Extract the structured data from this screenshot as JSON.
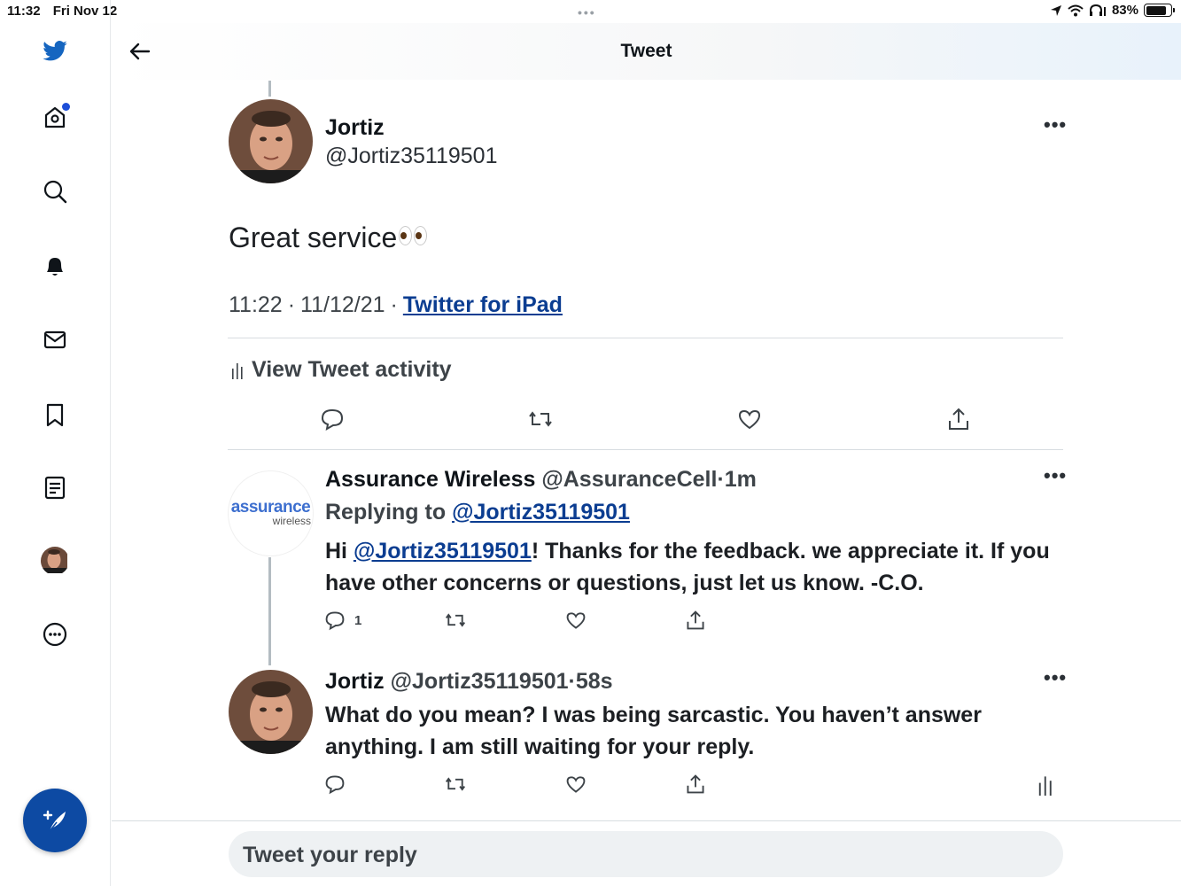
{
  "status_bar": {
    "time": "11:32",
    "date": "Fri Nov 12",
    "battery": "83%",
    "battery_level": 0.83
  },
  "header": {
    "title": "Tweet"
  },
  "sidebar": {
    "items": [
      "twitter-logo-icon",
      "home-icon",
      "search-icon",
      "notifications-icon",
      "messages-icon",
      "bookmarks-icon",
      "lists-icon",
      "profile-avatar",
      "more-icon"
    ],
    "accent": "#0d4aa3"
  },
  "main_tweet": {
    "name": "Jortiz",
    "handle": "@Jortiz35119501",
    "text": "Great service",
    "time": "11:22",
    "date": "11/12/21",
    "source": "Twitter for iPad",
    "activity_label": "View Tweet activity"
  },
  "replies": [
    {
      "name": "Assurance Wireless",
      "handle": "@AssuranceCell",
      "age": "1m",
      "replying_prefix": "Replying to",
      "replying_to": "@Jortiz35119501",
      "text_prefix": "Hi",
      "mention": "@Jortiz35119501",
      "text": "! Thanks for the feedback. we appreciate it. If you have other concerns or questions, just let us know.   -C.O.",
      "reply_count": "1",
      "logo_text": "assurance",
      "logo_sub": "wireless"
    },
    {
      "name": "Jortiz",
      "handle": "@Jortiz35119501",
      "age": "58s",
      "text": "What do you mean? I was being sarcastic. You haven’t answer anything. I am still waiting for your reply."
    }
  ],
  "reply_box": {
    "placeholder": "Tweet your reply"
  }
}
